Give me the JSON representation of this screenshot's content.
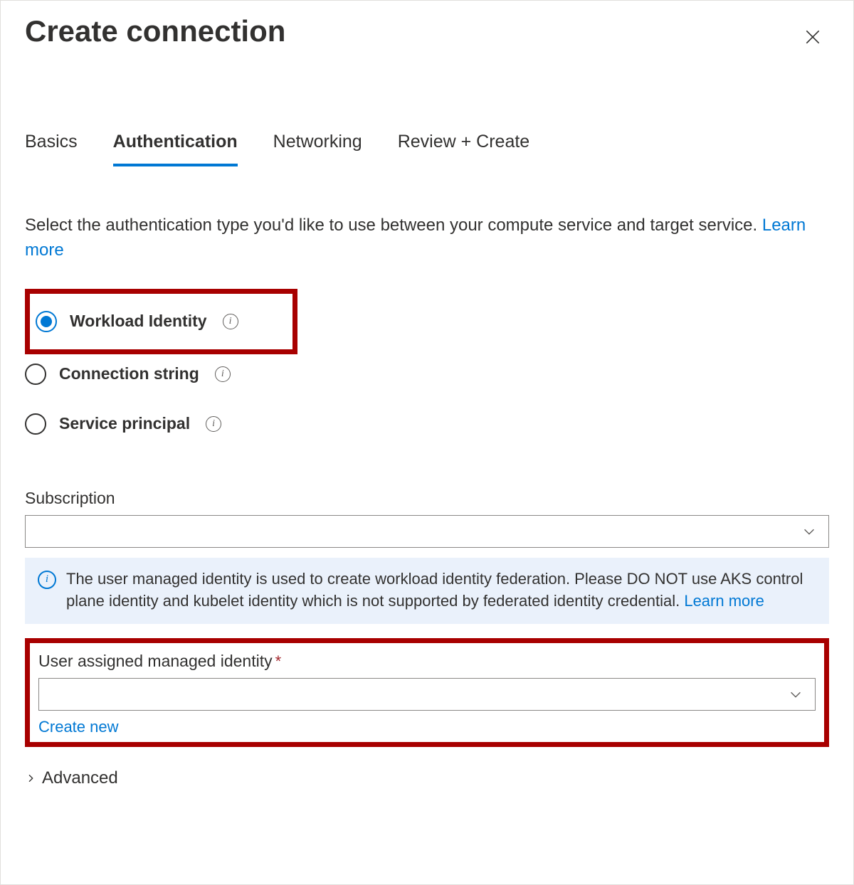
{
  "header": {
    "title": "Create connection"
  },
  "tabs": [
    {
      "label": "Basics"
    },
    {
      "label": "Authentication"
    },
    {
      "label": "Networking"
    },
    {
      "label": "Review + Create"
    }
  ],
  "help": {
    "text": "Select the authentication type you'd like to use between your compute service and target service. ",
    "link": "Learn more"
  },
  "auth_options": [
    {
      "label": "Workload Identity",
      "selected": true
    },
    {
      "label": "Connection string",
      "selected": false
    },
    {
      "label": "Service principal",
      "selected": false
    }
  ],
  "subscription": {
    "label": "Subscription",
    "value": ""
  },
  "info_panel": {
    "text": "The user managed identity is used to create workload identity federation. Please DO NOT use AKS control plane identity and kubelet identity which is not supported by federated identity credential. ",
    "link": "Learn more"
  },
  "uami": {
    "label": "User assigned managed identity",
    "value": "",
    "create_new": "Create new"
  },
  "advanced": {
    "label": "Advanced"
  }
}
